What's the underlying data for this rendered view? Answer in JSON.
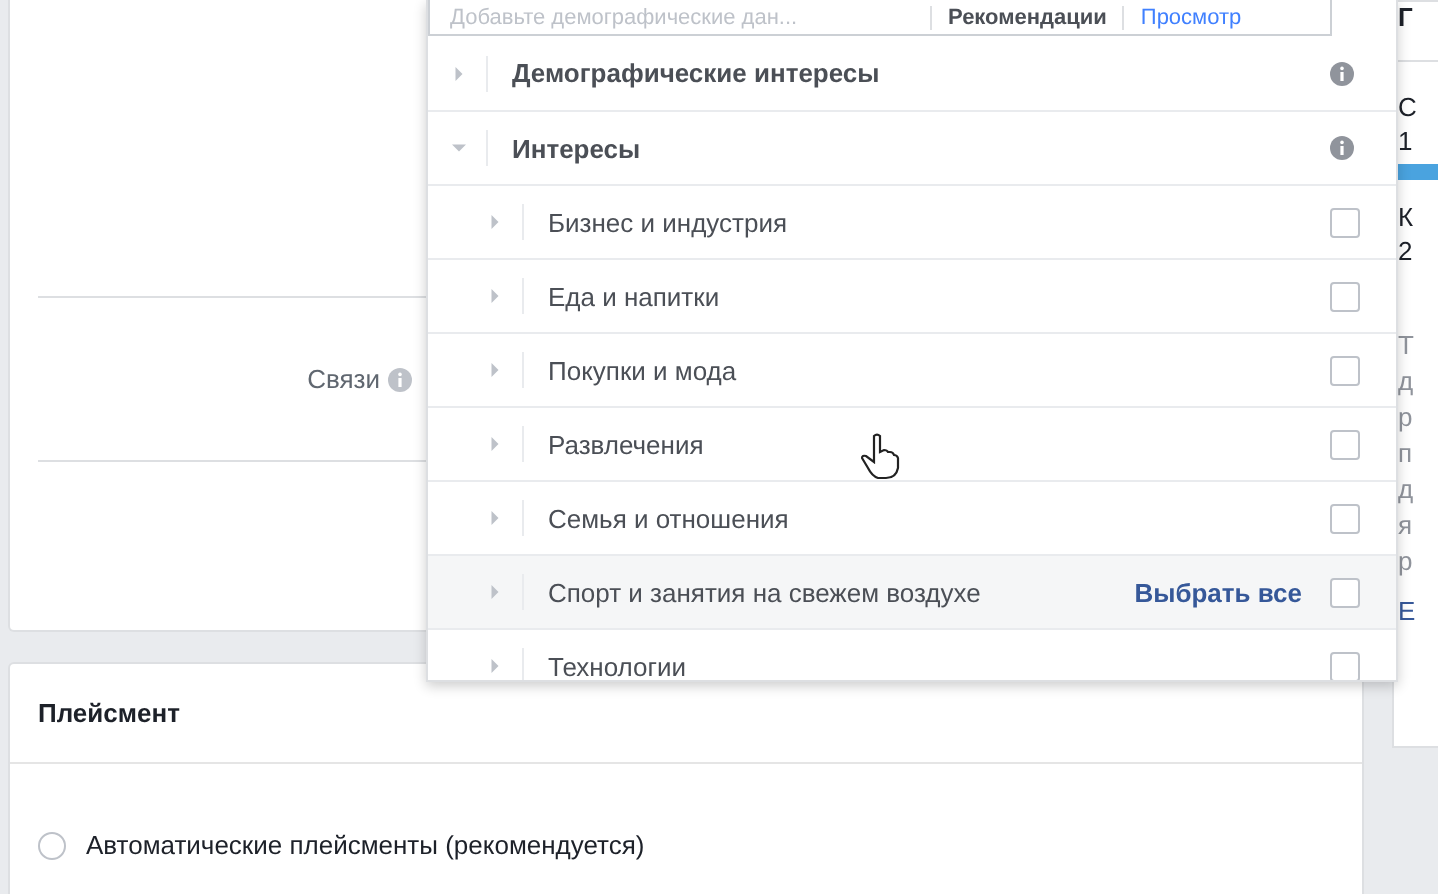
{
  "search_bar": {
    "placeholder": "Добавьте демографические дан...",
    "tabs": [
      {
        "label": "Рекомендации",
        "selected": false
      },
      {
        "label": "Просмотр",
        "selected": true
      }
    ]
  },
  "connections": {
    "label": "Связи"
  },
  "browse_tree": [
    {
      "label": "Демографические интересы",
      "expanded": false
    },
    {
      "label": "Интересы",
      "expanded": true,
      "children": [
        {
          "label": "Бизнес и индустрия",
          "checked": false
        },
        {
          "label": "Еда и напитки",
          "checked": false
        },
        {
          "label": "Покупки и мода",
          "checked": false
        },
        {
          "label": "Развлечения",
          "checked": false
        },
        {
          "label": "Семья и отношения",
          "checked": false
        },
        {
          "label": "Спорт и занятия на свежем воздухе",
          "checked": false,
          "action": "Выбрать все"
        },
        {
          "label": "Технологии",
          "checked": false
        }
      ]
    }
  ],
  "placement": {
    "title": "Плейсмент",
    "options": [
      {
        "label": "Автоматические плейсменты (рекомендуется)",
        "selected": false
      }
    ]
  },
  "right_panel": {
    "title": "Г",
    "metrics": [
      {
        "lines": [
          "С",
          "1"
        ],
        "bar": true
      },
      {
        "lines": [
          "К",
          "2"
        ],
        "bar": false
      }
    ],
    "paragraph_lines": [
      "Т",
      "д",
      "р",
      "п",
      "д",
      "я",
      "р"
    ],
    "link": "Е"
  }
}
